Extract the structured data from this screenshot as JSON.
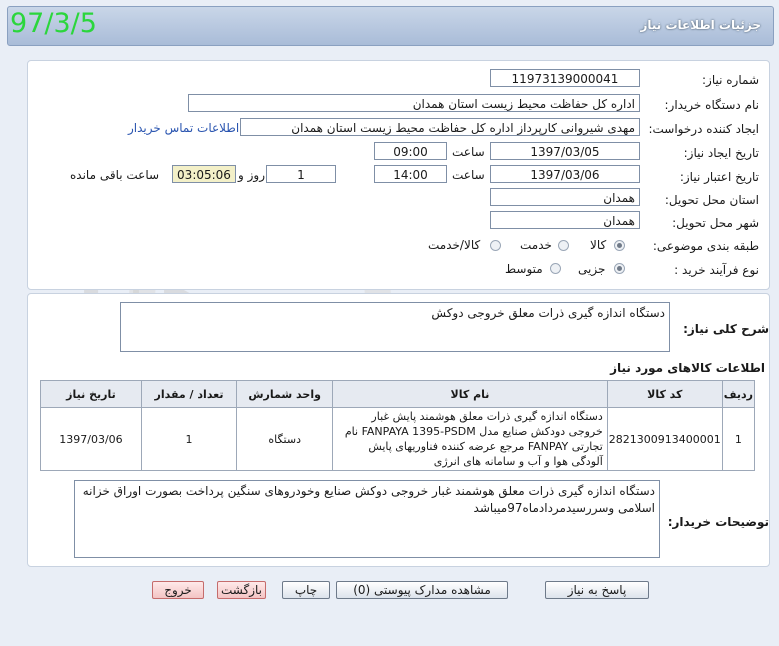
{
  "window": {
    "title": "جزئیات اطلاعات نیاز",
    "date_stamp": "97/3/5"
  },
  "form": {
    "need_number": {
      "label": "شماره نیاز:",
      "value": "11973139000041"
    },
    "buyer_org": {
      "label": "نام دستگاه خریدار:",
      "value": "اداره کل حفاظت محیط زیست استان همدان"
    },
    "requester": {
      "label": "ایجاد کننده درخواست:",
      "value": "مهدی شیروانی  کارپرداز اداره کل حفاظت محیط زیست استان همدان",
      "contact_link": "اطلاعات تماس خریدار"
    },
    "created": {
      "label": "تاریخ ایجاد نیاز:",
      "date": "1397/03/05",
      "time_label": "ساعت",
      "time": "09:00"
    },
    "valid_until": {
      "label": "تاریخ اعتبار نیاز:",
      "date": "1397/03/06",
      "time_label": "ساعت",
      "time": "14:00",
      "days": "1",
      "days_label": "روز و",
      "remaining": "03:05:06",
      "remaining_label": "ساعت باقی مانده"
    },
    "province": {
      "label": "استان محل تحویل:",
      "value": "همدان"
    },
    "city": {
      "label": "شهر محل تحویل:",
      "value": "همدان"
    },
    "category": {
      "label": "طبقه بندی موضوعی:",
      "options": [
        "کالا",
        "خدمت",
        "کالا/خدمت"
      ],
      "selected": "کالا"
    },
    "process": {
      "label": "نوع فرآیند خرید :",
      "options": [
        "جزیی",
        "متوسط"
      ],
      "selected": "جزیی"
    }
  },
  "description": {
    "label": "شرح کلی نیاز:",
    "value": "دستگاه اندازه گیری ذرات معلق خروجی  دوکش"
  },
  "goods": {
    "section_title": "اطلاعات کالاهای مورد نیاز",
    "headers": [
      "ردیف",
      "کد کالا",
      "نام کالا",
      "واحد شمارش",
      "تعداد / مقدار",
      "تاریخ نیاز"
    ],
    "rows": [
      {
        "row": "1",
        "code": "2821300913400001",
        "name": "دستگاه اندازه گیری ذرات معلق هوشمند پایش غبار خروجی دودکش صنایع مدل FANPAYA 1395-PSDM نام تجارتی FANPAY مرجع عرضه کننده فناوریهای پایش آلودگی هوا و آب و سامانه های انرژی",
        "unit": "دستگاه",
        "qty": "1",
        "date": "1397/03/06"
      }
    ]
  },
  "buyer_notes": {
    "label": "توضیحات خریدار:",
    "value": "دستگاه اندازه گیری ذرات معلق هوشمند غبار خروجی دوکش صنایع وخودروهای سنگین پرداخت بصورت اوراق خزانه اسلامی وسررسیدمردادماه97میباشد"
  },
  "buttons": {
    "reply": "پاسخ به نیاز",
    "attachments": "مشاهده مدارک پیوستی (0)",
    "print": "چاپ",
    "back": "بازگشت",
    "exit": "خروج"
  },
  "watermark": {
    "text": "هزاره",
    "sub": "ارتباط گستران"
  }
}
